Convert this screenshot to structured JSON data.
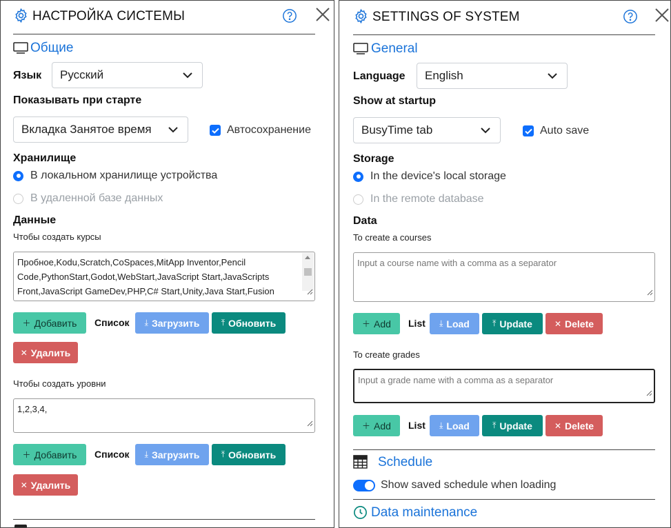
{
  "left": {
    "title": "НАСТРОЙКА СИСТЕМЫ",
    "general": "Общие",
    "language_label": "Язык",
    "language_value": "Русский",
    "startup_label": "Показывать при старте",
    "startup_value": "Вкладка Занятое время",
    "autosave_label": "Автосохранение",
    "storage_label": "Хранилище",
    "storage_local": "В локальном хранилище устройства",
    "storage_remote": "В удаленной базе данных",
    "data_label": "Данные",
    "courses_label": "Чтобы создать курсы",
    "courses_value": "Пробное,Kodu,Scratch,CoSpaces,MitApp Inventor,Pencil Code,PythonStart,Godot,WebStart,JavaScript Start,JavaScripts Front,JavaScript GameDev,PHP,C# Start,Unity,Java Start,Fusion",
    "grades_label": "Чтобы создать уровни",
    "grades_value": "1,2,3,4,",
    "add": "Добавить",
    "list": "Список",
    "load": "Загрузить",
    "update": "Обновить",
    "delete": "Удалить"
  },
  "right": {
    "title": "SETTINGS OF SYSTEM",
    "general": "General",
    "language_label": "Language",
    "language_value": "English",
    "startup_label": "Show at startup",
    "startup_value": "BusyTime tab",
    "autosave_label": "Auto save",
    "storage_label": "Storage",
    "storage_local": "In the device's local storage",
    "storage_remote": "In the remote database",
    "data_label": "Data",
    "courses_label": "To create a courses",
    "courses_placeholder": "Input a course name with a comma as a separator",
    "grades_label": "To create grades",
    "grades_placeholder": "Input a grade name with a comma as a separator",
    "add": "Add",
    "list": "List",
    "load": "Load",
    "update": "Update",
    "delete": "Delete",
    "schedule": "Schedule",
    "schedule_toggle_label": "Show saved schedule when loading",
    "maintenance": "Data maintenance"
  },
  "colors": {
    "accent": "#1a73d9",
    "primary": "#0d6efd",
    "add": "#48c7a6",
    "load": "#6fa3ee",
    "update": "#0b8a7f",
    "delete": "#d45d5d"
  }
}
